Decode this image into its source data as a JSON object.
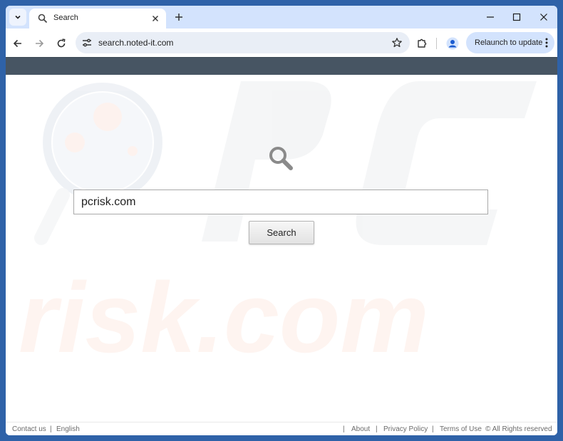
{
  "browser": {
    "tab_title": "Search",
    "url": "search.noted-it.com",
    "relaunch_label": "Relaunch to update"
  },
  "page": {
    "search_value": "pcrisk.com",
    "search_button": "Search"
  },
  "footer": {
    "contact": "Contact us",
    "sep": "|",
    "language": "English",
    "about": "About",
    "privacy": "Privacy Policy",
    "terms": "Terms of Use",
    "rights": "© All Rights reserved"
  },
  "watermark": {
    "letters_top": "PC",
    "text_bottom": "risk.com"
  },
  "colors": {
    "frame": "#2f62a8",
    "tabstrip": "#d3e3fd",
    "header_bar": "#475563",
    "relaunch_bg": "#d3e3fd"
  },
  "icons": [
    "chevron-down-icon",
    "search-icon",
    "close-icon",
    "plus-icon",
    "minimize-icon",
    "maximize-icon",
    "back-icon",
    "forward-icon",
    "reload-icon",
    "tune-icon",
    "star-icon",
    "extensions-icon",
    "profile-icon",
    "more-vertical-icon",
    "magnifier-icon"
  ]
}
